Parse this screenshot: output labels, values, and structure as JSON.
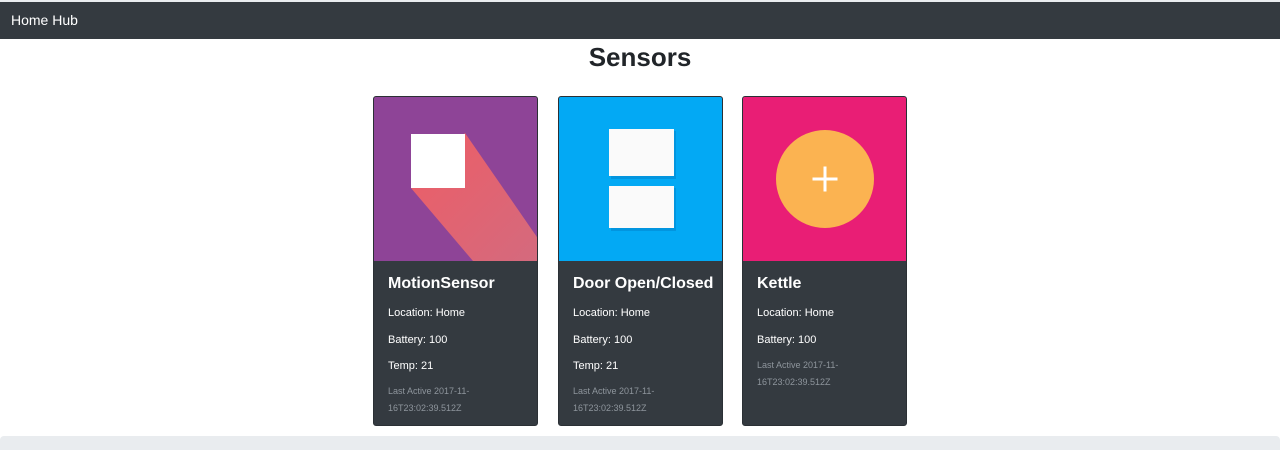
{
  "navbar": {
    "brand": "Home Hub"
  },
  "page": {
    "title": "Sensors"
  },
  "sensors": [
    {
      "name": "MotionSensor",
      "location": "Location: Home",
      "battery": "Battery: 100",
      "temp": "Temp: 21",
      "last_active": "Last Active 2017-11-16T23:02:39.512Z",
      "image_bg": "#8e4497"
    },
    {
      "name": "Door Open/Closed",
      "location": "Location: Home",
      "battery": "Battery: 100",
      "temp": "Temp: 21",
      "last_active": "Last Active 2017-11-16T23:02:39.512Z",
      "image_bg": "#03a9f4"
    },
    {
      "name": "Kettle",
      "location": "Location: Home",
      "battery": "Battery: 100",
      "last_active": "Last Active 2017-11-16T23:02:39.512Z",
      "image_bg": "#e91e75"
    }
  ],
  "colors": {
    "navbar_bg": "#343a40",
    "card_bg": "#343a40",
    "kettle_circle": "#fbb351",
    "motion_shadow": "#ee5d65"
  }
}
